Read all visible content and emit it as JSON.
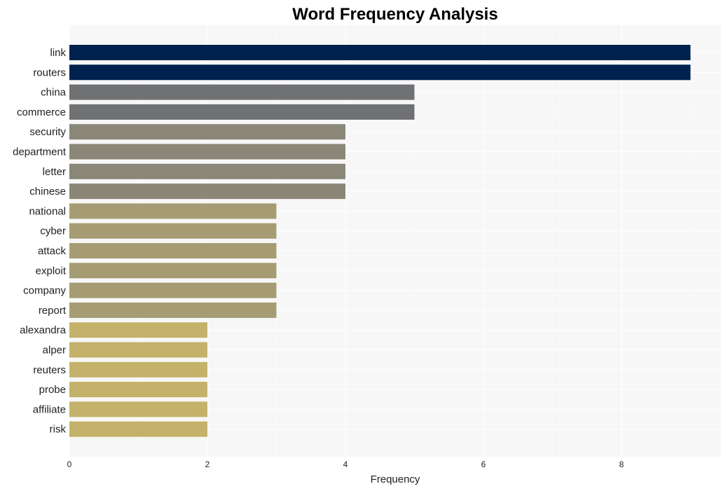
{
  "chart_data": {
    "type": "bar",
    "orientation": "horizontal",
    "title": "Word Frequency Analysis",
    "xlabel": "Frequency",
    "ylabel": "",
    "xlim": [
      0,
      9.45
    ],
    "xticks": [
      0,
      2,
      4,
      6,
      8
    ],
    "grid": true,
    "categories": [
      "link",
      "routers",
      "china",
      "commerce",
      "security",
      "department",
      "letter",
      "chinese",
      "national",
      "cyber",
      "attack",
      "exploit",
      "company",
      "report",
      "alexandra",
      "alper",
      "reuters",
      "probe",
      "affiliate",
      "risk"
    ],
    "values": [
      9,
      9,
      5,
      5,
      4,
      4,
      4,
      4,
      3,
      3,
      3,
      3,
      3,
      3,
      2,
      2,
      2,
      2,
      2,
      2
    ],
    "colors_by_value": {
      "9": "#00224e",
      "5": "#707173",
      "4": "#8a8778",
      "3": "#a59c74",
      "2": "#c4b26a"
    },
    "background_color": "#f7f7f7"
  }
}
